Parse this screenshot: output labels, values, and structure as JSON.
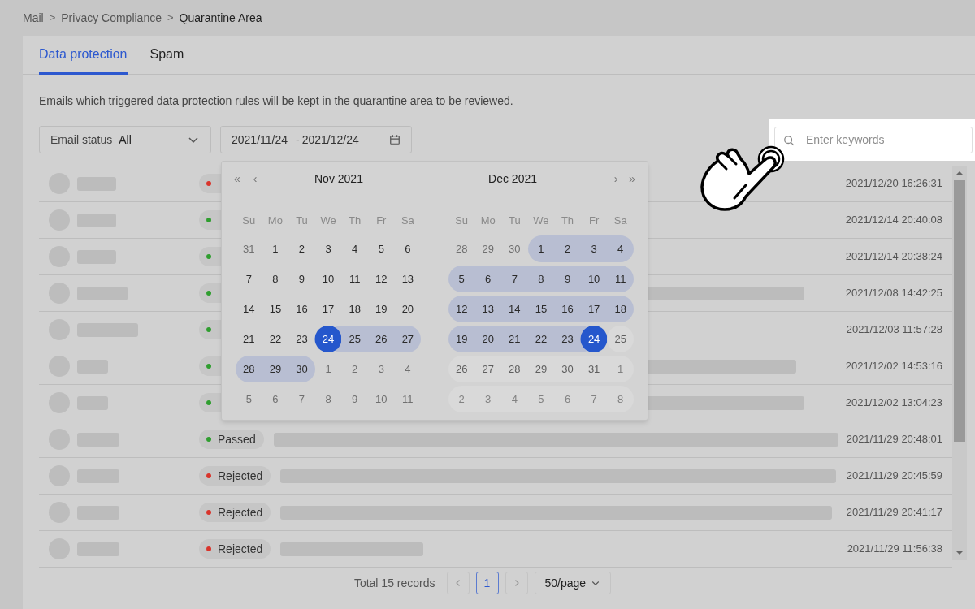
{
  "breadcrumb": [
    {
      "label": "Mail",
      "current": false
    },
    {
      "label": "Privacy Compliance",
      "current": false
    },
    {
      "label": "Quarantine Area",
      "current": true
    }
  ],
  "breadcrumb_separator": ">",
  "tabs": [
    {
      "label": "Data protection",
      "selected": true
    },
    {
      "label": "Spam",
      "selected": false
    }
  ],
  "description": "Emails which triggered data protection rules will be kept in the quarantine area to be reviewed.",
  "filters": {
    "status_label": "Email status",
    "status_value": "All",
    "date_start": "2021/11/24",
    "date_separator": "-",
    "date_end": "2021/12/24"
  },
  "search": {
    "placeholder": "Enter keywords"
  },
  "rows": [
    {
      "color": "#d9342b",
      "time": "2021/12/20 16:26:31"
    },
    {
      "color": "#2f9e2f",
      "time": "2021/12/14 20:40:08"
    },
    {
      "color": "#2f9e2f",
      "time": "2021/12/14 20:38:24"
    },
    {
      "color": "#2f9e2f",
      "time": "2021/12/08 14:42:25"
    },
    {
      "color": "#2f9e2f",
      "time": "2021/12/03 11:57:28"
    },
    {
      "color": "#2f9e2f",
      "time": "2021/12/02 14:53:16"
    },
    {
      "color": "#2f9e2f",
      "time": "2021/12/02 13:04:23"
    },
    {
      "status": "Passed",
      "color": "#2f9e2f",
      "time": "2021/11/29 20:48:01"
    },
    {
      "status": "Rejected",
      "color": "#d9342b",
      "time": "2021/11/29 20:45:59"
    },
    {
      "status": "Rejected",
      "color": "#d9342b",
      "time": "2021/11/29 20:41:17"
    },
    {
      "status": "Rejected",
      "color": "#d9342b",
      "time": "2021/11/29 11:56:38"
    }
  ],
  "calendar": {
    "nav_prev_year": "«",
    "nav_prev_month": "‹",
    "nav_next_month": "›",
    "nav_next_year": "»",
    "months": [
      {
        "title": "Nov 2021",
        "weekdays": [
          "Su",
          "Mo",
          "Tu",
          "We",
          "Th",
          "Fr",
          "Sa"
        ],
        "days": [
          {
            "d": "31",
            "muted": true,
            "in_range": false,
            "selected": false,
            "disabled": false
          },
          {
            "d": "1",
            "muted": false,
            "in_range": false,
            "selected": false,
            "disabled": false
          },
          {
            "d": "2",
            "muted": false,
            "in_range": false,
            "selected": false,
            "disabled": false
          },
          {
            "d": "3",
            "muted": false,
            "in_range": false,
            "selected": false,
            "disabled": false
          },
          {
            "d": "4",
            "muted": false,
            "in_range": false,
            "selected": false,
            "disabled": false
          },
          {
            "d": "5",
            "muted": false,
            "in_range": false,
            "selected": false,
            "disabled": false
          },
          {
            "d": "6",
            "muted": false,
            "in_range": false,
            "selected": false,
            "disabled": false
          },
          {
            "d": "7",
            "muted": false,
            "in_range": false,
            "selected": false,
            "disabled": false
          },
          {
            "d": "8",
            "muted": false,
            "in_range": false,
            "selected": false,
            "disabled": false
          },
          {
            "d": "9",
            "muted": false,
            "in_range": false,
            "selected": false,
            "disabled": false
          },
          {
            "d": "10",
            "muted": false,
            "in_range": false,
            "selected": false,
            "disabled": false
          },
          {
            "d": "11",
            "muted": false,
            "in_range": false,
            "selected": false,
            "disabled": false
          },
          {
            "d": "12",
            "muted": false,
            "in_range": false,
            "selected": false,
            "disabled": false
          },
          {
            "d": "13",
            "muted": false,
            "in_range": false,
            "selected": false,
            "disabled": false
          },
          {
            "d": "14",
            "muted": false,
            "in_range": false,
            "selected": false,
            "disabled": false
          },
          {
            "d": "15",
            "muted": false,
            "in_range": false,
            "selected": false,
            "disabled": false
          },
          {
            "d": "16",
            "muted": false,
            "in_range": false,
            "selected": false,
            "disabled": false
          },
          {
            "d": "17",
            "muted": false,
            "in_range": false,
            "selected": false,
            "disabled": false
          },
          {
            "d": "18",
            "muted": false,
            "in_range": false,
            "selected": false,
            "disabled": false
          },
          {
            "d": "19",
            "muted": false,
            "in_range": false,
            "selected": false,
            "disabled": false
          },
          {
            "d": "20",
            "muted": false,
            "in_range": false,
            "selected": false,
            "disabled": false
          },
          {
            "d": "21",
            "muted": false,
            "in_range": false,
            "selected": false,
            "disabled": false
          },
          {
            "d": "22",
            "muted": false,
            "in_range": false,
            "selected": false,
            "disabled": false
          },
          {
            "d": "23",
            "muted": false,
            "in_range": false,
            "selected": false,
            "disabled": false
          },
          {
            "d": "24",
            "muted": false,
            "in_range": true,
            "selected": true,
            "disabled": false
          },
          {
            "d": "25",
            "muted": false,
            "in_range": true,
            "selected": false,
            "disabled": false
          },
          {
            "d": "26",
            "muted": false,
            "in_range": true,
            "selected": false,
            "disabled": false
          },
          {
            "d": "27",
            "muted": false,
            "in_range": true,
            "selected": false,
            "disabled": false
          },
          {
            "d": "28",
            "muted": false,
            "in_range": true,
            "selected": false,
            "disabled": false
          },
          {
            "d": "29",
            "muted": false,
            "in_range": true,
            "selected": false,
            "disabled": false
          },
          {
            "d": "30",
            "muted": false,
            "in_range": true,
            "selected": false,
            "disabled": false
          },
          {
            "d": "1",
            "muted": true,
            "in_range": false,
            "selected": false,
            "disabled": false
          },
          {
            "d": "2",
            "muted": true,
            "in_range": false,
            "selected": false,
            "disabled": false
          },
          {
            "d": "3",
            "muted": true,
            "in_range": false,
            "selected": false,
            "disabled": false
          },
          {
            "d": "4",
            "muted": true,
            "in_range": false,
            "selected": false,
            "disabled": false
          },
          {
            "d": "5",
            "muted": true,
            "in_range": false,
            "selected": false,
            "disabled": false
          },
          {
            "d": "6",
            "muted": true,
            "in_range": false,
            "selected": false,
            "disabled": false
          },
          {
            "d": "7",
            "muted": true,
            "in_range": false,
            "selected": false,
            "disabled": false
          },
          {
            "d": "8",
            "muted": true,
            "in_range": false,
            "selected": false,
            "disabled": false
          },
          {
            "d": "9",
            "muted": true,
            "in_range": false,
            "selected": false,
            "disabled": false
          },
          {
            "d": "10",
            "muted": true,
            "in_range": false,
            "selected": false,
            "disabled": false
          },
          {
            "d": "11",
            "muted": true,
            "in_range": false,
            "selected": false,
            "disabled": false
          }
        ]
      },
      {
        "title": "Dec 2021",
        "weekdays": [
          "Su",
          "Mo",
          "Tu",
          "We",
          "Th",
          "Fr",
          "Sa"
        ],
        "days": [
          {
            "d": "28",
            "muted": true,
            "in_range": false,
            "selected": false,
            "disabled": false
          },
          {
            "d": "29",
            "muted": true,
            "in_range": false,
            "selected": false,
            "disabled": false
          },
          {
            "d": "30",
            "muted": true,
            "in_range": false,
            "selected": false,
            "disabled": false
          },
          {
            "d": "1",
            "muted": false,
            "in_range": true,
            "selected": false,
            "disabled": false
          },
          {
            "d": "2",
            "muted": false,
            "in_range": true,
            "selected": false,
            "disabled": false
          },
          {
            "d": "3",
            "muted": false,
            "in_range": true,
            "selected": false,
            "disabled": false
          },
          {
            "d": "4",
            "muted": false,
            "in_range": true,
            "selected": false,
            "disabled": false
          },
          {
            "d": "5",
            "muted": false,
            "in_range": true,
            "selected": false,
            "disabled": false
          },
          {
            "d": "6",
            "muted": false,
            "in_range": true,
            "selected": false,
            "disabled": false
          },
          {
            "d": "7",
            "muted": false,
            "in_range": true,
            "selected": false,
            "disabled": false
          },
          {
            "d": "8",
            "muted": false,
            "in_range": true,
            "selected": false,
            "disabled": false
          },
          {
            "d": "9",
            "muted": false,
            "in_range": true,
            "selected": false,
            "disabled": false
          },
          {
            "d": "10",
            "muted": false,
            "in_range": true,
            "selected": false,
            "disabled": false
          },
          {
            "d": "11",
            "muted": false,
            "in_range": true,
            "selected": false,
            "disabled": false
          },
          {
            "d": "12",
            "muted": false,
            "in_range": true,
            "selected": false,
            "disabled": false
          },
          {
            "d": "13",
            "muted": false,
            "in_range": true,
            "selected": false,
            "disabled": false
          },
          {
            "d": "14",
            "muted": false,
            "in_range": true,
            "selected": false,
            "disabled": false
          },
          {
            "d": "15",
            "muted": false,
            "in_range": true,
            "selected": false,
            "disabled": false
          },
          {
            "d": "16",
            "muted": false,
            "in_range": true,
            "selected": false,
            "disabled": false
          },
          {
            "d": "17",
            "muted": false,
            "in_range": true,
            "selected": false,
            "disabled": false
          },
          {
            "d": "18",
            "muted": false,
            "in_range": true,
            "selected": false,
            "disabled": false
          },
          {
            "d": "19",
            "muted": false,
            "in_range": true,
            "selected": false,
            "disabled": false
          },
          {
            "d": "20",
            "muted": false,
            "in_range": true,
            "selected": false,
            "disabled": false
          },
          {
            "d": "21",
            "muted": false,
            "in_range": true,
            "selected": false,
            "disabled": false
          },
          {
            "d": "22",
            "muted": false,
            "in_range": true,
            "selected": false,
            "disabled": false
          },
          {
            "d": "23",
            "muted": false,
            "in_range": true,
            "selected": false,
            "disabled": false
          },
          {
            "d": "24",
            "muted": false,
            "in_range": true,
            "selected": true,
            "disabled": false
          },
          {
            "d": "25",
            "muted": false,
            "in_range": false,
            "selected": false,
            "disabled": true
          },
          {
            "d": "26",
            "muted": false,
            "in_range": false,
            "selected": false,
            "disabled": true
          },
          {
            "d": "27",
            "muted": false,
            "in_range": false,
            "selected": false,
            "disabled": true
          },
          {
            "d": "28",
            "muted": false,
            "in_range": false,
            "selected": false,
            "disabled": true
          },
          {
            "d": "29",
            "muted": false,
            "in_range": false,
            "selected": false,
            "disabled": true
          },
          {
            "d": "30",
            "muted": false,
            "in_range": false,
            "selected": false,
            "disabled": true
          },
          {
            "d": "31",
            "muted": false,
            "in_range": false,
            "selected": false,
            "disabled": true
          },
          {
            "d": "1",
            "muted": true,
            "in_range": false,
            "selected": false,
            "disabled": true
          },
          {
            "d": "2",
            "muted": true,
            "in_range": false,
            "selected": false,
            "disabled": true
          },
          {
            "d": "3",
            "muted": true,
            "in_range": false,
            "selected": false,
            "disabled": true
          },
          {
            "d": "4",
            "muted": true,
            "in_range": false,
            "selected": false,
            "disabled": true
          },
          {
            "d": "5",
            "muted": true,
            "in_range": false,
            "selected": false,
            "disabled": true
          },
          {
            "d": "6",
            "muted": true,
            "in_range": false,
            "selected": false,
            "disabled": true
          },
          {
            "d": "7",
            "muted": true,
            "in_range": false,
            "selected": false,
            "disabled": true
          },
          {
            "d": "8",
            "muted": true,
            "in_range": false,
            "selected": false,
            "disabled": true
          }
        ]
      }
    ]
  },
  "pagination": {
    "total": "Total 15 records",
    "pages": [
      {
        "label": "1",
        "selected": true
      }
    ],
    "page_size": "50/page"
  }
}
